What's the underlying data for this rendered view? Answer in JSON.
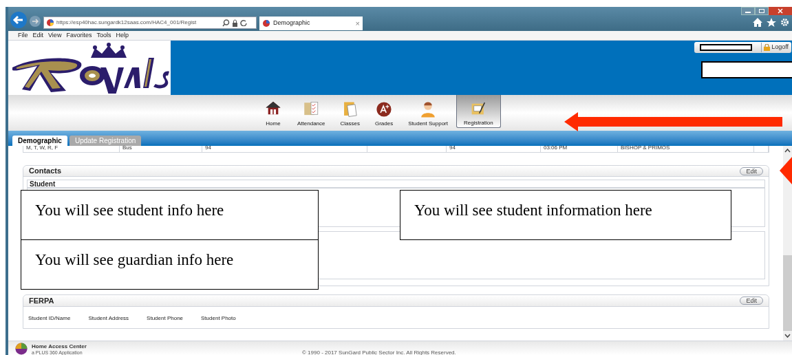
{
  "browser": {
    "url": "https://esp40hac.sungardk12saas.com/HAC4_001/Regist",
    "tab_title": "Demographic",
    "tab_close": "×",
    "menu": [
      "File",
      "Edit",
      "View",
      "Favorites",
      "Tools",
      "Help"
    ]
  },
  "header": {
    "logoff": "Logoff"
  },
  "nav": [
    {
      "label": "Home",
      "selected": false,
      "kind": "home"
    },
    {
      "label": "Attendance",
      "selected": false,
      "kind": "attendance"
    },
    {
      "label": "Classes",
      "selected": false,
      "kind": "classes"
    },
    {
      "label": "Grades",
      "selected": false,
      "kind": "grades"
    },
    {
      "label": "Student Support",
      "selected": false,
      "kind": "support"
    },
    {
      "label": "Registration",
      "selected": true,
      "kind": "registration"
    }
  ],
  "tabs": [
    {
      "label": "Demographic",
      "selected": true
    },
    {
      "label": "Update Registration",
      "selected": false
    }
  ],
  "transport_row": [
    "M, T, W, R, F",
    "Bus",
    "94",
    "94",
    "03:06 PM",
    "BISHOP & PRIMOS"
  ],
  "contacts": {
    "title": "Contacts",
    "edit": "Edit",
    "student_heading": "Student"
  },
  "annotations": [
    "You will see student info here",
    "You will see student information here",
    "You will see guardian info here"
  ],
  "ferpa": {
    "title": "FERPA",
    "edit": "Edit",
    "items": [
      "Student ID/Name",
      "Student Address",
      "Student Phone",
      "Student Photo"
    ]
  },
  "footer": {
    "app": "Home Access Center",
    "subtitle": "a PLUS 360 Application",
    "copyright": "© 1990 - 2017 SunGard Public Sector Inc. All Rights Reserved."
  }
}
